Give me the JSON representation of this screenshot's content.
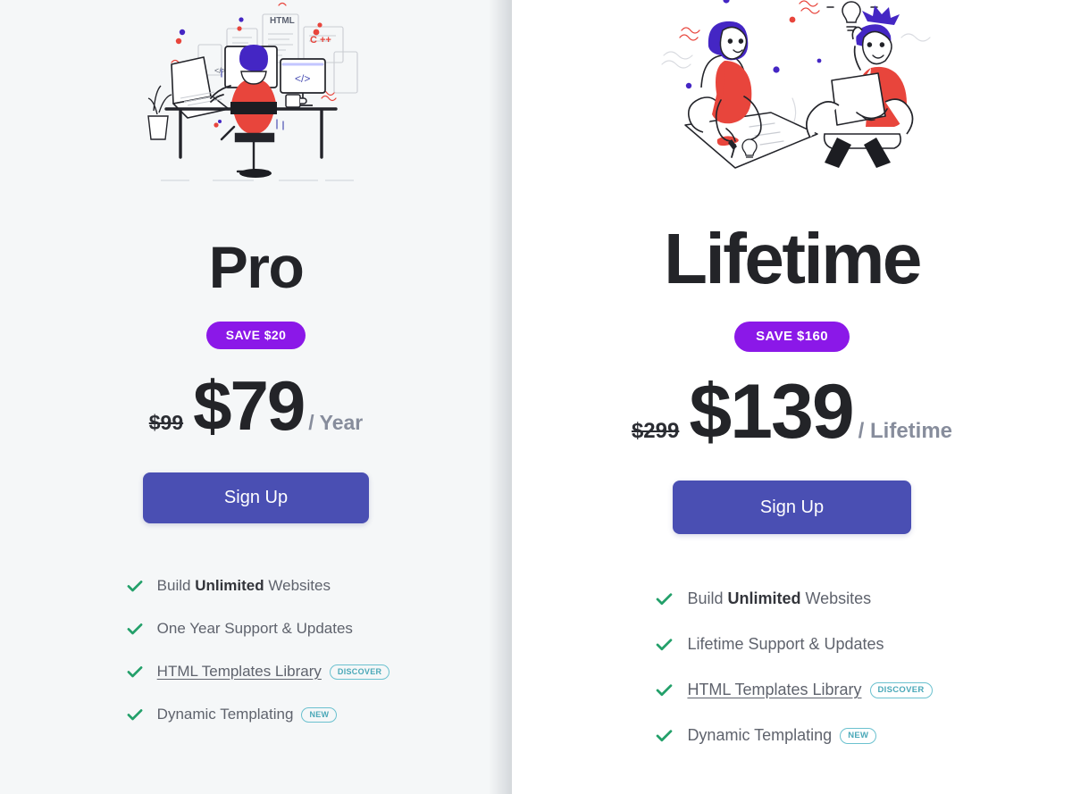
{
  "colors": {
    "accent_purple": "#8b18e8",
    "button_indigo": "#4a4fb3",
    "check_green": "#23a06a",
    "badge_teal": "#4aa8b8",
    "title_dark": "#232428",
    "feature_gray": "#5f636d",
    "period_gray": "#878d9c",
    "card_gray_bg": "#f5f7f8",
    "card_white_bg": "#ffffff"
  },
  "plans": [
    {
      "id": "pro",
      "illustration_name": "developer-at-desk-illustration",
      "title": "Pro",
      "save_badge": "SAVE $20",
      "price_old": "$99",
      "price_new": "$79",
      "price_period": "/ Year",
      "cta_label": "Sign Up",
      "features": [
        {
          "text_before": "Build ",
          "text_bold": "Unlimited",
          "text_after": " Websites",
          "link": false,
          "badge": null
        },
        {
          "text_before": "One Year Support & Updates",
          "text_bold": "",
          "text_after": "",
          "link": false,
          "badge": null
        },
        {
          "text_before": "HTML Templates Library",
          "text_bold": "",
          "text_after": "",
          "link": true,
          "badge": "DISCOVER"
        },
        {
          "text_before": "Dynamic Templating",
          "text_bold": "",
          "text_after": "",
          "link": false,
          "badge": "NEW"
        }
      ]
    },
    {
      "id": "lifetime",
      "illustration_name": "two-people-brainstorming-illustration",
      "title": "Lifetime",
      "save_badge": "SAVE $160",
      "price_old": "$299",
      "price_new": "$139",
      "price_period": "/ Lifetime",
      "cta_label": "Sign Up",
      "features": [
        {
          "text_before": "Build ",
          "text_bold": "Unlimited",
          "text_after": " Websites",
          "link": false,
          "badge": null
        },
        {
          "text_before": "Lifetime Support & Updates",
          "text_bold": "",
          "text_after": "",
          "link": false,
          "badge": null
        },
        {
          "text_before": "HTML Templates Library",
          "text_bold": "",
          "text_after": "",
          "link": true,
          "badge": "DISCOVER"
        },
        {
          "text_before": "Dynamic Templating",
          "text_bold": "",
          "text_after": "",
          "link": false,
          "badge": "NEW"
        }
      ]
    }
  ]
}
